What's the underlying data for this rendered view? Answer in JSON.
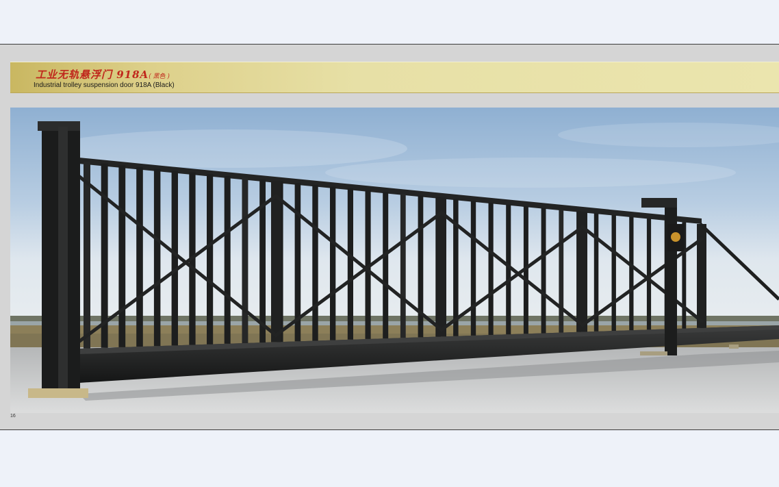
{
  "header": {
    "title_cn": "工业无轨悬浮门 918A",
    "title_cn_color_tag": "( 黑色 )",
    "title_en": "Industrial trolley suspension door 918A (Black)"
  },
  "photo": {
    "subject": "gate-photo"
  },
  "footer": {
    "page_number": "16"
  },
  "colors": {
    "page_background": "#eef2f9",
    "panel_background": "#d5d5d5",
    "title_band": "#e7e0a6",
    "title_cn": "#c0271c",
    "gate_metal": "#1e1f1f"
  }
}
